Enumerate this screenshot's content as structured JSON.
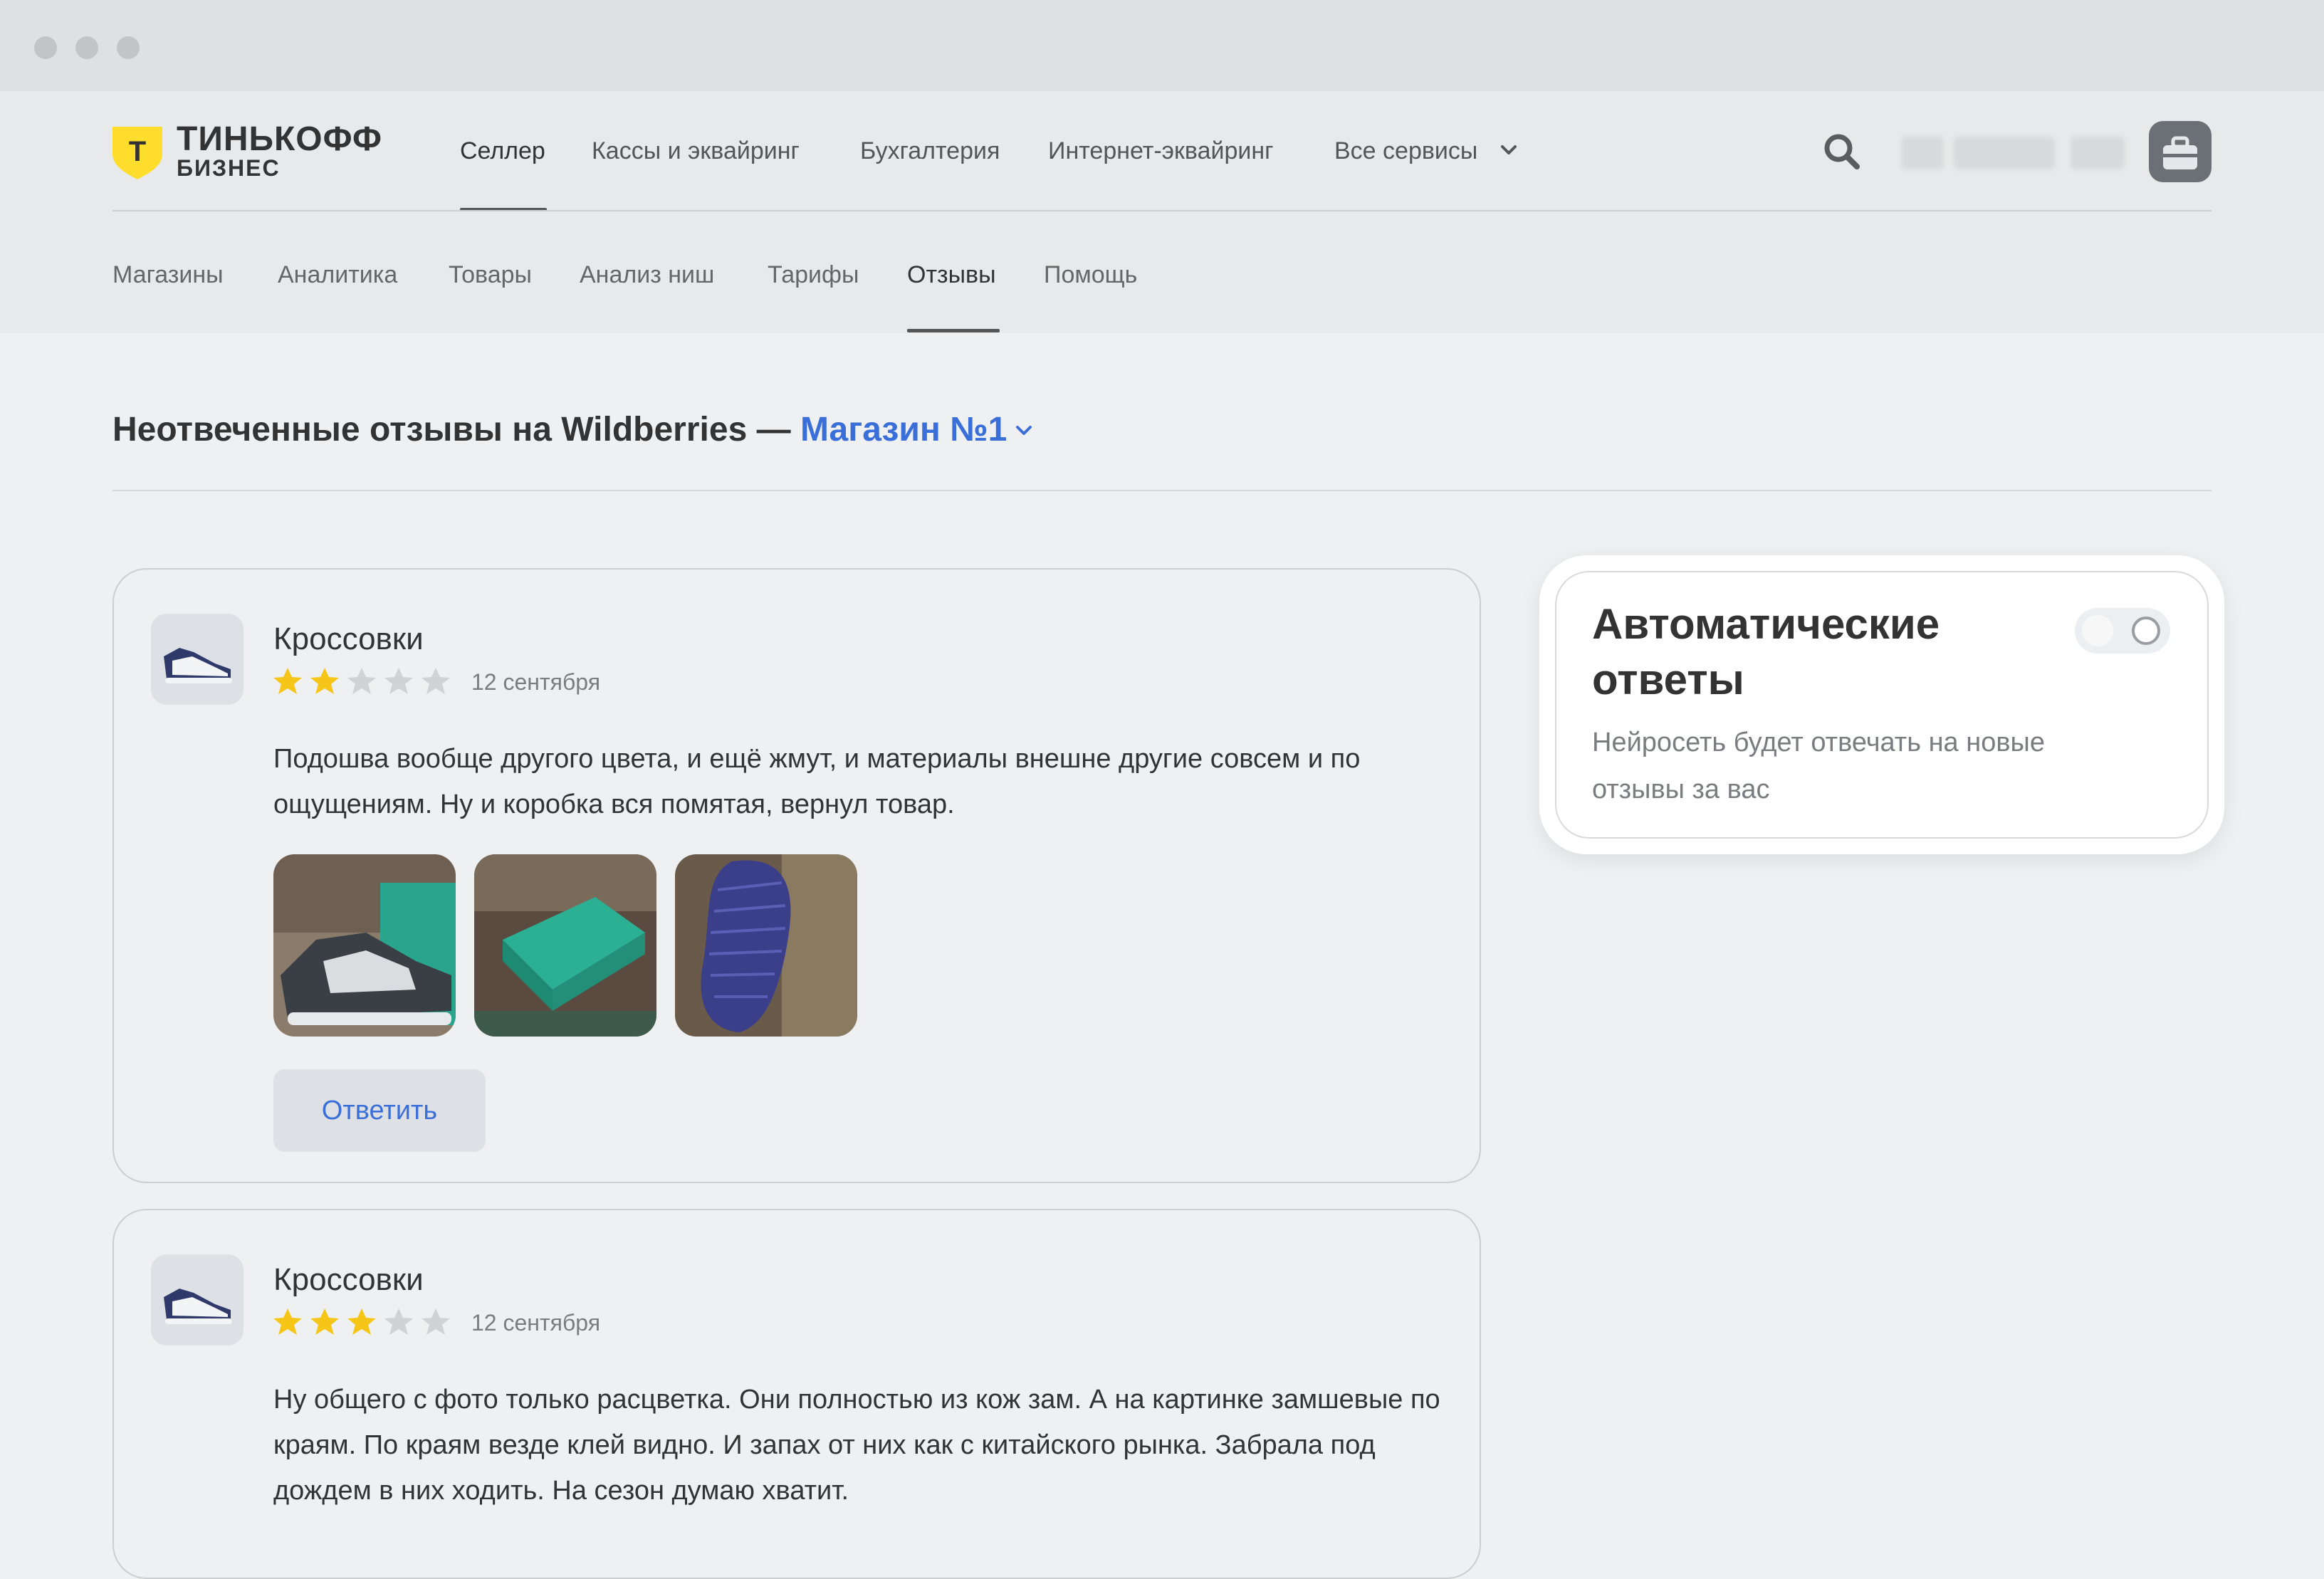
{
  "window": {
    "controls": [
      "close",
      "minimize",
      "maximize"
    ]
  },
  "brand": {
    "name_line1": "ТИНЬКОФФ",
    "name_line2": "БИЗНЕС",
    "badge_letter": "T",
    "accent": "#FFDD2D"
  },
  "top_nav": {
    "items": [
      {
        "label": "Селлер",
        "active": true
      },
      {
        "label": "Кассы и эквайринг",
        "active": false
      },
      {
        "label": "Бухгалтерия",
        "active": false
      },
      {
        "label": "Интернет-эквайринг",
        "active": false
      },
      {
        "label": "Все сервисы",
        "active": false,
        "icon": "chevron-down-icon"
      }
    ]
  },
  "header_actions": {
    "search_icon": "search-icon",
    "avatar_icon": "briefcase-icon"
  },
  "sub_nav": {
    "items": [
      {
        "label": "Магазины",
        "active": false
      },
      {
        "label": "Аналитика",
        "active": false
      },
      {
        "label": "Товары",
        "active": false
      },
      {
        "label": "Анализ ниш",
        "active": false
      },
      {
        "label": "Тарифы",
        "active": false
      },
      {
        "label": "Отзывы",
        "active": true
      },
      {
        "label": "Помощь",
        "active": false
      }
    ]
  },
  "page": {
    "title_prefix": "Неотвеченные отзывы на Wildberries — ",
    "store_selected": "Магазин №1",
    "link_color": "#3A6FD9"
  },
  "reviews": [
    {
      "product": "Кроссовки",
      "rating": 2,
      "max_rating": 5,
      "date": "12 сентября",
      "text": "Подошва вообще другого цвета, и ещё жмут, и материалы внешне другие совсем и по ощущениям. Ну и коробка вся помятая, вернул товар.",
      "photos": [
        "sneaker-photo",
        "shoebox-photo",
        "sole-photo"
      ],
      "reply_label": "Ответить"
    },
    {
      "product": "Кроссовки",
      "rating": 3,
      "max_rating": 5,
      "date": "12 сентября",
      "text": "Ну общего с фото только расцветка. Они полностью из кож зам. А на картинке замшевые по краям. По краям везде клей видно. И запах от них как с китайского рынка. Забрала под дождем в них ходить. На сезон думаю хватит."
    }
  ],
  "auto_replies": {
    "title": "Автоматические ответы",
    "description": "Нейросеть будет отвечать на новые отзывы за вас",
    "enabled": false
  },
  "colors": {
    "star_filled": "#F5C518",
    "star_empty": "#D0D2D6"
  }
}
